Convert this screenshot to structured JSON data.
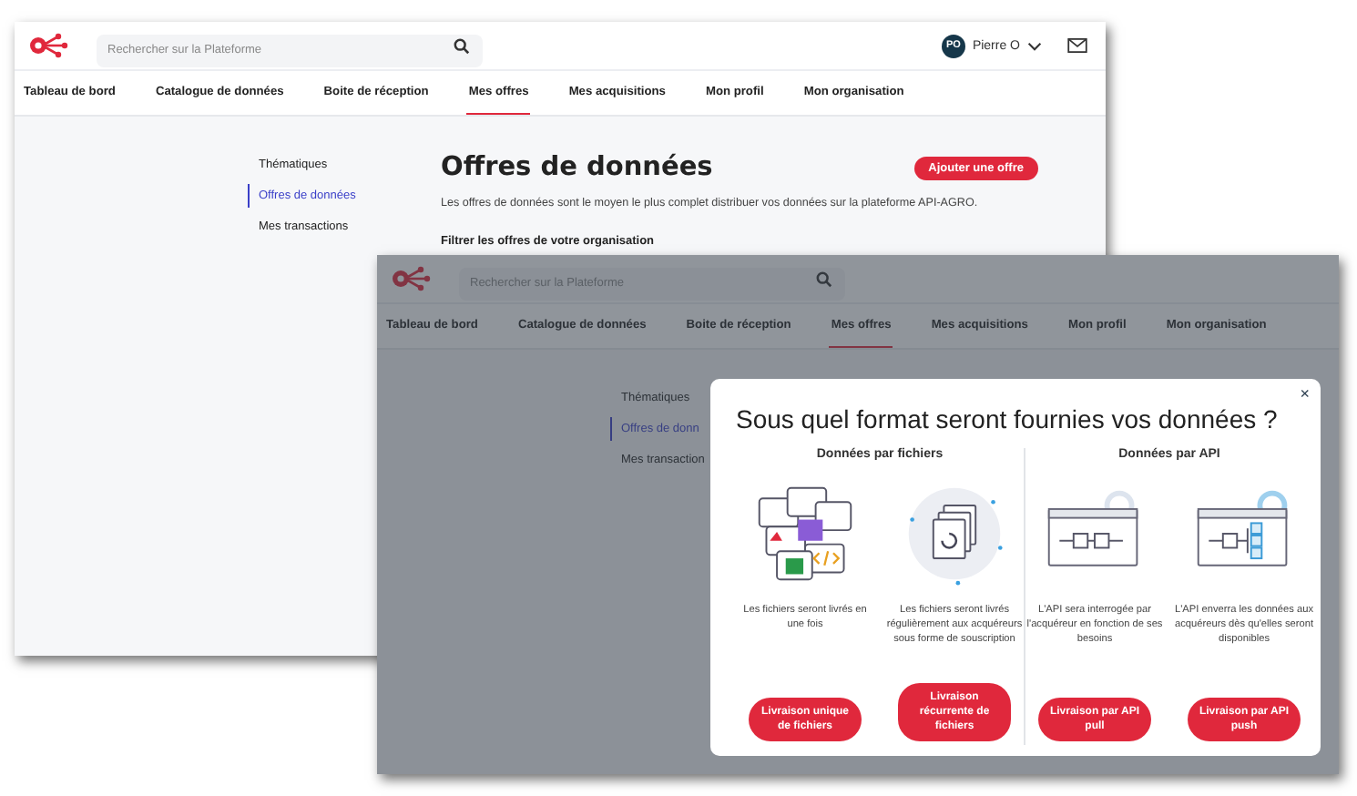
{
  "back_window": {
    "search": {
      "placeholder": "Rechercher sur la Plateforme"
    },
    "user": {
      "initials": "PO",
      "name": "Pierre O"
    },
    "nav": [
      {
        "label": "Tableau de bord",
        "selected": false
      },
      {
        "label": "Catalogue de données",
        "selected": false
      },
      {
        "label": "Boite de réception",
        "selected": false
      },
      {
        "label": "Mes offres",
        "selected": true
      },
      {
        "label": "Mes acquisitions",
        "selected": false
      },
      {
        "label": "Mon profil",
        "selected": false
      },
      {
        "label": "Mon organisation",
        "selected": false
      }
    ],
    "sidebar": [
      {
        "label": "Thématiques",
        "selected": false
      },
      {
        "label": "Offres de données",
        "selected": true
      },
      {
        "label": "Mes transactions",
        "selected": false
      }
    ],
    "page": {
      "title": "Offres de données",
      "add_button": "Ajouter une offre",
      "description": "Les offres de données sont le moyen le plus complet distribuer vos données sur la plateforme API-AGRO.",
      "filter_label": "Filtrer les offres de votre organisation"
    }
  },
  "front_window": {
    "search": {
      "placeholder": "Rechercher sur la Plateforme"
    },
    "nav": [
      {
        "label": "Tableau de bord",
        "selected": false
      },
      {
        "label": "Catalogue de données",
        "selected": false
      },
      {
        "label": "Boite de réception",
        "selected": false
      },
      {
        "label": "Mes offres",
        "selected": true
      },
      {
        "label": "Mes acquisitions",
        "selected": false
      },
      {
        "label": "Mon profil",
        "selected": false
      },
      {
        "label": "Mon organisation",
        "selected": false
      }
    ],
    "sidebar": [
      {
        "label": "Thématiques",
        "selected": false
      },
      {
        "label": "Offres de donn",
        "selected": true
      },
      {
        "label": "Mes transaction",
        "selected": false
      }
    ],
    "modal": {
      "title": "Sous quel format seront fournies vos données ?",
      "close": "×",
      "sections": [
        {
          "heading": "Données par fichiers",
          "options": [
            {
              "kind": "files_once",
              "description": "Les fichiers seront livrés en une fois",
              "button": "Livraison unique de fichiers"
            },
            {
              "kind": "files_recurring",
              "description": "Les fichiers seront livrés régulièrement aux acquéreurs sous forme de souscription",
              "button": "Livraison récurrente de fichiers"
            }
          ]
        },
        {
          "heading": "Données par API",
          "options": [
            {
              "kind": "api_pull",
              "description": "L'API sera interrogée par l'acquéreur en fonction de ses besoins",
              "button": "Livraison par API pull"
            },
            {
              "kind": "api_push",
              "description": "L'API enverra les données aux acquéreurs dès qu'elles seront disponibles",
              "button": "Livraison par API push"
            }
          ]
        }
      ]
    }
  }
}
